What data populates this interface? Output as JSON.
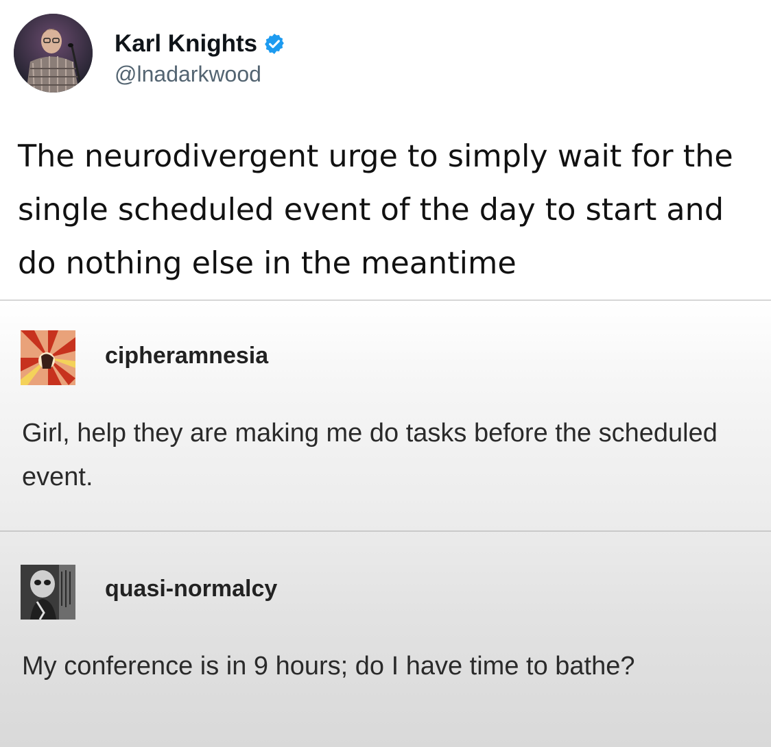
{
  "tweet": {
    "author_name": "Karl Knights",
    "author_handle": "@lnadarkwood",
    "verified_icon": "verified-badge-icon",
    "text": "The neurodivergent urge to simply wait for the single scheduled event of the day to start and do nothing else in the meantime"
  },
  "replies": [
    {
      "username": "cipheramnesia",
      "text": "Girl, help they are making me do tasks before the scheduled event."
    },
    {
      "username": "quasi-normalcy",
      "text": "My conference is in 9 hours; do I have time to bathe?"
    }
  ],
  "colors": {
    "verified_blue": "#1d9bf0",
    "handle_gray": "#536471",
    "divider": "#d6d6d6"
  }
}
